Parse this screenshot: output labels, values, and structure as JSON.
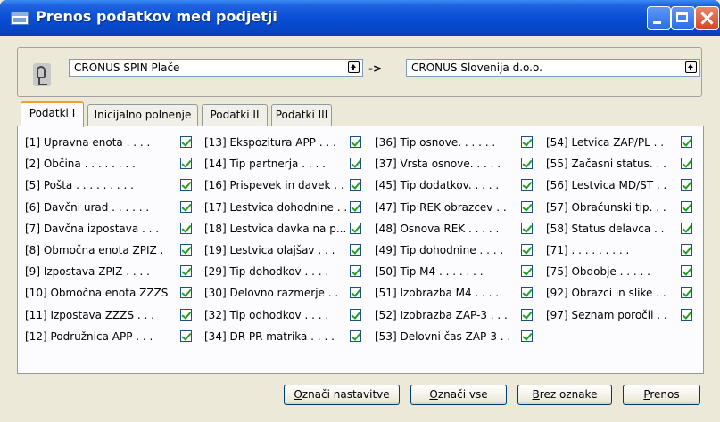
{
  "window": {
    "title": "Prenos podatkov med podjetji"
  },
  "companies": {
    "from": "CRONUS SPIN Plače",
    "arrow": "->",
    "to": "CRONUS Slovenija d.o.o."
  },
  "tabs": [
    {
      "label": "Podatki I",
      "active": true
    },
    {
      "label": "Inicijalno polnenje",
      "active": false
    },
    {
      "label": "Podatki II",
      "active": false
    },
    {
      "label": "Podatki III",
      "active": false
    }
  ],
  "columns": [
    [
      {
        "label": "[1] Upravna enota . . . .",
        "checked": true
      },
      {
        "label": "[2] Občina . . . . . . . .",
        "checked": true
      },
      {
        "label": "[5] Pošta . . . . . . . . .",
        "checked": true
      },
      {
        "label": "[6] Davčni urad . . . . . .",
        "checked": true
      },
      {
        "label": "[7] Davčna izpostava . . .",
        "checked": true
      },
      {
        "label": "[8] Območna enota ZPIZ .",
        "checked": true
      },
      {
        "label": "[9] Izpostava ZPIZ . . . .",
        "checked": true
      },
      {
        "label": "[10] Območna enota ZZZS",
        "checked": true
      },
      {
        "label": "[11] Izpostava ZZZS . . .",
        "checked": true
      },
      {
        "label": "[12] Podružnica APP . . .",
        "checked": true
      }
    ],
    [
      {
        "label": "[13] Ekspozitura APP . . .",
        "checked": true
      },
      {
        "label": "[14] Tip partnerja . . . .",
        "checked": true
      },
      {
        "label": "[16] Prispevek in davek . .",
        "checked": true
      },
      {
        "label": "[17] Lestvica dohodnine . .",
        "checked": true
      },
      {
        "label": "[18] Lestvica davka na p...",
        "checked": true
      },
      {
        "label": "[19] Lestvica olajšav . . .",
        "checked": true
      },
      {
        "label": "[29] Tip dohodkov . . . .",
        "checked": true
      },
      {
        "label": "[30] Delovno razmerje . .",
        "checked": true
      },
      {
        "label": "[32] Tip odhodkov . . . .",
        "checked": true
      },
      {
        "label": "[34] DR-PR matrika . . . .",
        "checked": true
      }
    ],
    [
      {
        "label": "[36] Tip osnove. . . . . .",
        "checked": true
      },
      {
        "label": "[37] Vrsta osnove. . . . .",
        "checked": true
      },
      {
        "label": "[45] Tip dodatkov. . . . .",
        "checked": true
      },
      {
        "label": "[47] Tip REK obrazcev . .",
        "checked": true
      },
      {
        "label": "[48] Osnova REK . . . . .",
        "checked": true
      },
      {
        "label": "[49] Tip dohodnine . . . .",
        "checked": true
      },
      {
        "label": "[50] Tip M4 . . . . . . .",
        "checked": true
      },
      {
        "label": "[51] Izobrazba M4 . . . .",
        "checked": true
      },
      {
        "label": "[52] Izobrazba ZAP-3 . . .",
        "checked": true
      },
      {
        "label": "[53] Delovni čas ZAP-3 . .",
        "checked": true
      }
    ],
    [
      {
        "label": "[54] Letvica ZAP/PL . .",
        "checked": true
      },
      {
        "label": "[55] Začasni status. . .",
        "checked": true
      },
      {
        "label": "[56] Lestvica MD/ST . .",
        "checked": true
      },
      {
        "label": "[57] Obračunski tip. . .",
        "checked": true
      },
      {
        "label": "[58] Status delavca . .",
        "checked": true
      },
      {
        "label": "[71] . . . . . . . . .",
        "checked": true
      },
      {
        "label": "[75] Obdobje . . . . .",
        "checked": true
      },
      {
        "label": "[92] Obrazci in slike . .",
        "checked": true
      },
      {
        "label": "[97] Seznam poročil . .",
        "checked": true
      }
    ]
  ],
  "buttons": [
    {
      "pre": "",
      "key": "O",
      "post": "znači nastavitve"
    },
    {
      "pre": "",
      "key": "O",
      "post": "znači vse"
    },
    {
      "pre": "",
      "key": "B",
      "post": "rez oznake"
    },
    {
      "pre": "",
      "key": "P",
      "post": "renos"
    }
  ]
}
